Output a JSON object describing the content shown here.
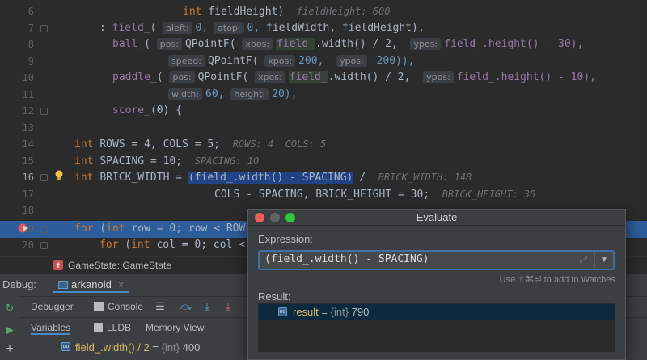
{
  "editor": {
    "line_numbers": [
      "6",
      "7",
      "8",
      "9",
      "10",
      "11",
      "12",
      "13",
      "14",
      "15",
      "16",
      "17",
      "18",
      "19",
      "20"
    ],
    "current_line": "16",
    "lines": {
      "l6": {
        "type": "int",
        "name": "fieldHeight)",
        "inlay": "fieldHeight: 600"
      },
      "l7": {
        "prefix": ": ",
        "fn": "field_",
        "open": "(",
        "hint1": "aleft:",
        "v1": "0,",
        "hint2": "atop:",
        "v2": "0,",
        "rest": "fieldWidth, fieldHeight),"
      },
      "l8": {
        "fn": "ball_",
        "open": "(",
        "hint1": "pos:",
        "cls": "QPointF(",
        "hint2": "xpos:",
        "field": "field_",
        "mid": ".width() / 2,",
        "hint3": "ypos:",
        "tail": "field_.height() - 30),"
      },
      "l9": {
        "hint1": "speed:",
        "cls": "QPointF(",
        "hint2": "xpos:",
        "v1": "200,",
        "hint3": "ypos:",
        "v2": "-200)),"
      },
      "l10": {
        "fn": "paddle_",
        "open": "(",
        "hint1": "pos:",
        "cls": "QPointF(",
        "hint2": "xpos:",
        "field": "field_",
        "mid": ".width() / 2,",
        "hint3": "ypos:",
        "tail": "field_.height() - 10),"
      },
      "l11": {
        "hint1": "width:",
        "v1": "60,",
        "hint2": "height:",
        "v2": "20),"
      },
      "l12": {
        "fn": "score_",
        "rest": "(0) {"
      },
      "l14": {
        "kw": "int",
        "text": "ROWS = 4, COLS = 5;",
        "inlay": "ROWS: 4  COLS: 5"
      },
      "l15": {
        "kw": "int",
        "text": "SPACING = 10;",
        "inlay": "SPACING: 10"
      },
      "l16": {
        "kw": "int",
        "name": "BRICK_WIDTH = ",
        "sel": "(field_.width() - SPACING)",
        "after": " /",
        "inlay": "BRICK_WIDTH: 148"
      },
      "l16b": {
        "text": "COLS - SPACING, BRICK_HEIGHT = 30;",
        "inlay": "BRICK_HEIGHT: 30"
      },
      "l19": {
        "kw1": "for",
        "open": " (",
        "kw2": "int",
        "text": " row = 0; row < ROW"
      },
      "l20": {
        "kw1": "for",
        "open": " (",
        "kw2": "int",
        "text": " col = 0; col <"
      }
    }
  },
  "breadcrumb": {
    "badge": "f",
    "text": "GameState::GameState"
  },
  "debug": {
    "label": "Debug:",
    "session_tab": "arkanoid",
    "toolbar": {
      "debugger": "Debugger",
      "console": "Console"
    },
    "subtabs": {
      "variables": "Variables",
      "lldb": "LLDB",
      "memory": "Memory View"
    },
    "var_row": {
      "name": "field_.width() / 2",
      "eq": " = ",
      "type": "{int}",
      "value": " 400"
    }
  },
  "dialog": {
    "title": "Evaluate",
    "expression_label": "Expression:",
    "expression": "(field_.width() - SPACING)",
    "watch_hint": "Use ⇧⌘⏎ to add to Watches",
    "result_label": "Result:",
    "result": {
      "name": "result",
      "eq": " = ",
      "type": "{int}",
      "value": " 790"
    }
  },
  "colors": {
    "accent": "#2d5d9b",
    "keyword": "#cc7832",
    "number": "#6897bb",
    "function": "#ffc66d",
    "field": "#9876aa"
  }
}
